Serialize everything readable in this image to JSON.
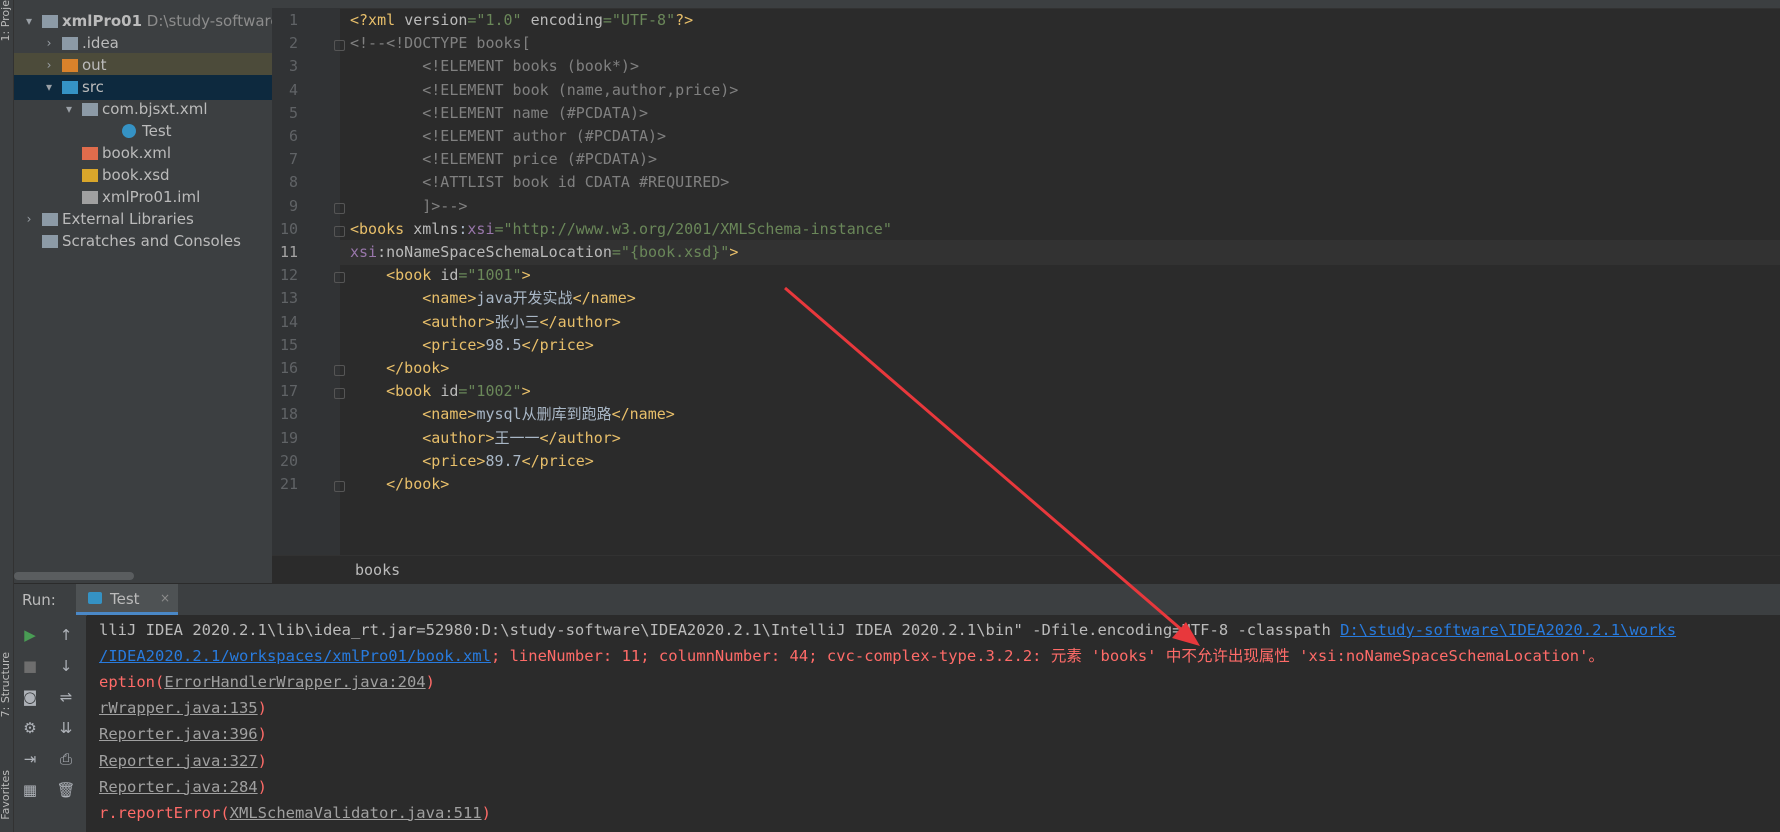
{
  "left_strip": {
    "project_label": "1: Proje",
    "structure_label": "7: Structure",
    "favorites_label": "Favorites"
  },
  "project_tree": [
    {
      "label": "xmlPro01",
      "hint": "D:\\study-software",
      "indent": 0,
      "arrow": "▾",
      "icon": "module-folder-icon",
      "bold": true
    },
    {
      "label": ".idea",
      "indent": 1,
      "arrow": "›",
      "icon": "folder-icon"
    },
    {
      "label": "out",
      "indent": 1,
      "arrow": "›",
      "icon": "excluded-folder-icon",
      "selected": "out"
    },
    {
      "label": "src",
      "indent": 1,
      "arrow": "▾",
      "icon": "source-folder-icon",
      "selected": "src"
    },
    {
      "label": "com.bjsxt.xml",
      "indent": 2,
      "arrow": "▾",
      "icon": "package-icon"
    },
    {
      "label": "Test",
      "indent": 4,
      "arrow": "",
      "icon": "java-class-icon"
    },
    {
      "label": "book.xml",
      "indent": 2,
      "arrow": "",
      "icon": "xml-file-icon"
    },
    {
      "label": "book.xsd",
      "indent": 2,
      "arrow": "",
      "icon": "xsd-file-icon"
    },
    {
      "label": "xmlPro01.iml",
      "indent": 2,
      "arrow": "",
      "icon": "iml-file-icon"
    },
    {
      "label": "External Libraries",
      "indent": 0,
      "arrow": "›",
      "icon": "libraries-icon"
    },
    {
      "label": "Scratches and Consoles",
      "indent": 0,
      "arrow": "",
      "icon": "scratches-icon"
    }
  ],
  "editor": {
    "current_line": 11,
    "lines": [
      {
        "n": "1",
        "parts": [
          [
            "t",
            "<?xml "
          ],
          [
            "a",
            "version"
          ],
          [
            "v",
            "=\"1.0\" "
          ],
          [
            "a",
            "encoding"
          ],
          [
            "v",
            "=\"UTF-8\""
          ],
          [
            "t",
            "?>"
          ]
        ]
      },
      {
        "n": "2",
        "parts": [
          [
            "c",
            "<!--<!DOCTYPE books["
          ]
        ]
      },
      {
        "n": "3",
        "parts": [
          [
            "c",
            "        <!ELEMENT books (book*)>"
          ]
        ]
      },
      {
        "n": "4",
        "parts": [
          [
            "c",
            "        <!ELEMENT book (name,author,price)>"
          ]
        ]
      },
      {
        "n": "5",
        "parts": [
          [
            "c",
            "        <!ELEMENT name (#PCDATA)>"
          ]
        ]
      },
      {
        "n": "6",
        "parts": [
          [
            "c",
            "        <!ELEMENT author (#PCDATA)>"
          ]
        ]
      },
      {
        "n": "7",
        "parts": [
          [
            "c",
            "        <!ELEMENT price (#PCDATA)>"
          ]
        ]
      },
      {
        "n": "8",
        "parts": [
          [
            "c",
            "        <!ATTLIST book id CDATA #REQUIRED>"
          ]
        ]
      },
      {
        "n": "9",
        "parts": [
          [
            "c",
            "        ]>-->"
          ]
        ]
      },
      {
        "n": "10",
        "parts": [
          [
            "t",
            "<books "
          ],
          [
            "a",
            "xmlns"
          ],
          [
            "txt",
            ":"
          ],
          [
            "ns",
            "xsi"
          ],
          [
            "v",
            "=\"http://www.w3.org/2001/XMLSchema-instance\""
          ]
        ]
      },
      {
        "n": "11",
        "parts": [
          [
            "ns",
            "xsi"
          ],
          [
            "a",
            ":noNameSpaceSchemaLocation"
          ],
          [
            "v",
            "=\"{book.xsd}\""
          ],
          [
            "t",
            ">"
          ]
        ]
      },
      {
        "n": "12",
        "parts": [
          [
            "t",
            "    <book "
          ],
          [
            "a",
            "id"
          ],
          [
            "v",
            "=\"1001\""
          ],
          [
            "t",
            ">"
          ]
        ]
      },
      {
        "n": "13",
        "parts": [
          [
            "t",
            "        <name>"
          ],
          [
            "txt",
            "java开发实战"
          ],
          [
            "t",
            "</name>"
          ]
        ]
      },
      {
        "n": "14",
        "parts": [
          [
            "t",
            "        <author>"
          ],
          [
            "txt",
            "张小三"
          ],
          [
            "t",
            "</author>"
          ]
        ]
      },
      {
        "n": "15",
        "parts": [
          [
            "t",
            "        <price>"
          ],
          [
            "txt",
            "98.5"
          ],
          [
            "t",
            "</price>"
          ]
        ]
      },
      {
        "n": "16",
        "parts": [
          [
            "t",
            "    </book>"
          ]
        ]
      },
      {
        "n": "17",
        "parts": [
          [
            "t",
            "    <book "
          ],
          [
            "a",
            "id"
          ],
          [
            "v",
            "=\"1002\""
          ],
          [
            "t",
            ">"
          ]
        ]
      },
      {
        "n": "18",
        "parts": [
          [
            "t",
            "        <name>"
          ],
          [
            "txt",
            "mysql从删库到跑路"
          ],
          [
            "t",
            "</name>"
          ]
        ]
      },
      {
        "n": "19",
        "parts": [
          [
            "t",
            "        <author>"
          ],
          [
            "txt",
            "王一一"
          ],
          [
            "t",
            "</author>"
          ]
        ]
      },
      {
        "n": "20",
        "parts": [
          [
            "t",
            "        <price>"
          ],
          [
            "txt",
            "89.7"
          ],
          [
            "t",
            "</price>"
          ]
        ]
      },
      {
        "n": "21",
        "parts": [
          [
            "t",
            "    </book>"
          ]
        ]
      }
    ],
    "breadcrumb": "books"
  },
  "run_panel": {
    "label": "Run:",
    "tab_label": "Test",
    "tab_close": "×",
    "toolbar_icons": [
      "rerun-icon",
      "up-arrow-icon",
      "stop-icon",
      "down-arrow-icon",
      "camera-icon",
      "soft-wrap-icon",
      "settings-icon",
      "scroll-to-end-icon",
      "exit-icon",
      "print-icon",
      "layout-icon",
      "trash-icon"
    ],
    "console_lines": [
      [
        [
          "cmd",
          "lliJ IDEA 2020.2.1\\lib\\idea_rt.jar=52980:D:\\study-software\\IDEA2020.2.1\\IntelliJ IDEA 2020.2.1\\bin\" -Dfile.encoding=UTF-8 -classpath "
        ],
        [
          "link",
          "D:\\study-software\\IDEA2020.2.1\\works"
        ]
      ],
      [
        [
          "link",
          "/IDEA2020.2.1/workspaces/xmlPro01/book.xml"
        ],
        [
          "err",
          "; lineNumber: 11; columnNumber: 44; cvc-complex-type.3.2.2: 元素 'books' 中不允许出现属性 'xsi:noNameSpaceSchemaLocation'。"
        ]
      ],
      [
        [
          "err",
          "eption("
        ],
        [
          "elink",
          "ErrorHandlerWrapper.java:204"
        ],
        [
          "err",
          ")"
        ]
      ],
      [
        [
          "elink",
          "rWrapper.java:135"
        ],
        [
          "err",
          ")"
        ]
      ],
      [
        [
          "elink",
          "Reporter.java:396"
        ],
        [
          "err",
          ")"
        ]
      ],
      [
        [
          "elink",
          "Reporter.java:327"
        ],
        [
          "err",
          ")"
        ]
      ],
      [
        [
          "elink",
          "Reporter.java:284"
        ],
        [
          "err",
          ")"
        ]
      ],
      [
        [
          "err",
          "r.reportError("
        ],
        [
          "elink",
          "XMLSchemaValidator.java:511"
        ],
        [
          "err",
          ")"
        ]
      ]
    ]
  },
  "colors": {
    "annotation_arrow": "#e8383c",
    "selection_src": "#0d293e",
    "selection_out": "#4c4b3a"
  }
}
